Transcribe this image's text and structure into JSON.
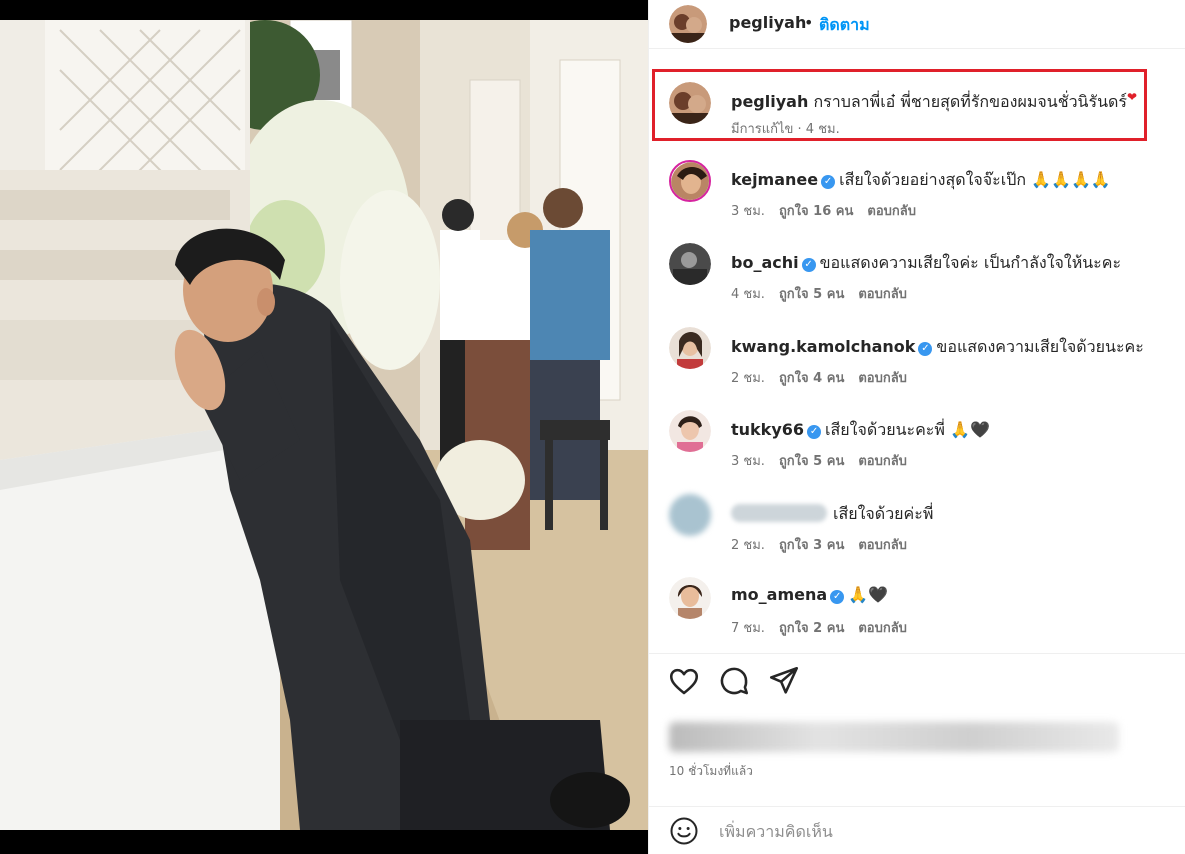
{
  "post": {
    "author": "pegliyah",
    "separator": "•",
    "follow_label": "ติดตาม",
    "caption": {
      "username": "pegliyah",
      "text": "กราบลาพี่เอ๋ พี่ชายสุดที่รักของผมจนชั่วนิรันดร์",
      "edited_label": "มีการแก้ไข · 4 ชม."
    }
  },
  "comments": [
    {
      "username": "kejmanee",
      "verified": true,
      "text": "เสียใจด้วยอย่างสุดใจจ๊ะเป๊ก 🙏🙏🙏🙏",
      "time": "3 ชม.",
      "likes": "ถูกใจ 16 คน",
      "reply": "ตอบกลับ"
    },
    {
      "username": "bo_achi",
      "verified": true,
      "text": "ขอแสดงความเสียใจค่ะ เป็นกำลังใจให้นะคะ",
      "time": "4 ชม.",
      "likes": "ถูกใจ 5 คน",
      "reply": "ตอบกลับ"
    },
    {
      "username": "kwang.kamolchanok",
      "verified": true,
      "text": "ขอแสดงความเสียใจด้วยนะคะ",
      "time": "2 ชม.",
      "likes": "ถูกใจ 4 คน",
      "reply": "ตอบกลับ"
    },
    {
      "username": "tukky66",
      "verified": true,
      "text": "เสียใจด้วยนะคะพี่ 🙏🖤",
      "time": "3 ชม.",
      "likes": "ถูกใจ 5 คน",
      "reply": "ตอบกลับ"
    },
    {
      "username": "",
      "verified": false,
      "text": "เสียใจด้วยค่ะพี่",
      "time": "2 ชม.",
      "likes": "ถูกใจ 3 คน",
      "reply": "ตอบกลับ"
    },
    {
      "username": "mo_amena",
      "verified": true,
      "text": "🙏🖤",
      "time": "7 ชม.",
      "likes": "ถูกใจ 2 คน",
      "reply": "ตอบกลับ"
    }
  ],
  "footer": {
    "time_ago": "10 ชั่วโมงที่แล้ว",
    "add_comment_placeholder": "เพิ่มความคิดเห็น"
  },
  "icons": {
    "like": "heart-icon",
    "comment": "comment-bubble-icon",
    "share": "paper-plane-icon",
    "emoji": "smiley-icon",
    "verified": "verified-badge-icon"
  },
  "colors": {
    "link": "#0095f6",
    "verified": "#3897f0",
    "highlight_border": "#e0202a",
    "meta_text": "#737373"
  }
}
